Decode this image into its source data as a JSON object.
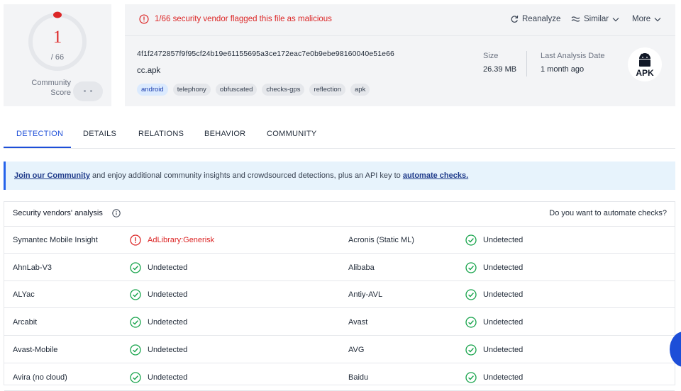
{
  "score": {
    "detections": "1",
    "total": "/ 66",
    "community_label_1": "Community",
    "community_label_2": "Score"
  },
  "header": {
    "alert_text": "1/66 security vendor flagged this file as malicious",
    "reanalyze": "Reanalyze",
    "similar": "Similar",
    "more": "More",
    "hash": "4f1f2472857f9f95cf24b19e61155695a3ce172eac7e0b9ebe98160040e51e66",
    "filename": "cc.apk",
    "tags": [
      "android",
      "telephony",
      "obfuscated",
      "checks-gps",
      "reflection",
      "apk"
    ],
    "size_label": "Size",
    "size_value": "26.39 MB",
    "last_analysis_label": "Last Analysis Date",
    "last_analysis_value": "1 month ago",
    "file_type_badge": "APK"
  },
  "tabs": [
    "DETECTION",
    "DETAILS",
    "RELATIONS",
    "BEHAVIOR",
    "COMMUNITY"
  ],
  "active_tab": "DETECTION",
  "banner": {
    "link1": "Join our Community",
    "middle": " and enjoy additional community insights and crowdsourced detections, plus an API key to ",
    "link2": "automate checks."
  },
  "vendors": {
    "title": "Security vendors' analysis",
    "automate_prompt": "Do you want to automate checks?",
    "rows": [
      {
        "left": {
          "name": "Symantec Mobile Insight",
          "result": "AdLibrary:Generisk",
          "status": "malicious"
        },
        "right": {
          "name": "Acronis (Static ML)",
          "result": "Undetected",
          "status": "clean"
        }
      },
      {
        "left": {
          "name": "AhnLab-V3",
          "result": "Undetected",
          "status": "clean"
        },
        "right": {
          "name": "Alibaba",
          "result": "Undetected",
          "status": "clean"
        }
      },
      {
        "left": {
          "name": "ALYac",
          "result": "Undetected",
          "status": "clean"
        },
        "right": {
          "name": "Antiy-AVL",
          "result": "Undetected",
          "status": "clean"
        }
      },
      {
        "left": {
          "name": "Arcabit",
          "result": "Undetected",
          "status": "clean"
        },
        "right": {
          "name": "Avast",
          "result": "Undetected",
          "status": "clean"
        }
      },
      {
        "left": {
          "name": "Avast-Mobile",
          "result": "Undetected",
          "status": "clean"
        },
        "right": {
          "name": "AVG",
          "result": "Undetected",
          "status": "clean"
        }
      },
      {
        "left": {
          "name": "Avira (no cloud)",
          "result": "Undetected",
          "status": "clean"
        },
        "right": {
          "name": "Baidu",
          "result": "Undetected",
          "status": "clean"
        }
      }
    ]
  },
  "colors": {
    "malicious": "#dc2626",
    "clean": "#16a34a",
    "accent": "#1d4ed8"
  },
  "icons": {
    "alert": "alert-circle-icon",
    "reanalyze": "refresh-icon",
    "similar": "similar-icon",
    "chevron": "chevron-down-icon",
    "info": "info-icon",
    "clean": "check-circle-icon",
    "malicious": "alert-circle-icon",
    "file_type": "android-icon"
  }
}
